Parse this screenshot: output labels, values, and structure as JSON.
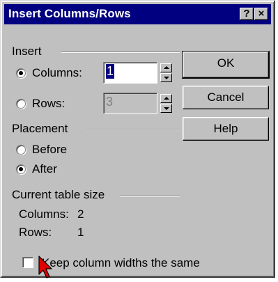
{
  "dialog": {
    "title": "Insert Columns/Rows",
    "help_button": "?",
    "close_button": "×"
  },
  "insert_group": {
    "label": "Insert",
    "columns": {
      "label": "Columns:",
      "value": "1",
      "checked": true
    },
    "rows": {
      "label": "Rows:",
      "value": "3",
      "checked": false,
      "disabled": true
    }
  },
  "placement_group": {
    "label": "Placement",
    "before": {
      "label": "Before",
      "checked": false
    },
    "after": {
      "label": "After",
      "checked": true
    }
  },
  "current_size": {
    "label": "Current table size",
    "columns_label": "Columns:",
    "columns_value": "2",
    "rows_label": "Rows:",
    "rows_value": "1"
  },
  "buttons": {
    "ok": "OK",
    "cancel": "Cancel",
    "help": "Help"
  },
  "keep_widths": {
    "label": "Keep column widths the same",
    "checked": false
  },
  "colors": {
    "titlebar": "#000080",
    "face": "#c0c0c0",
    "selection": "#000080"
  }
}
